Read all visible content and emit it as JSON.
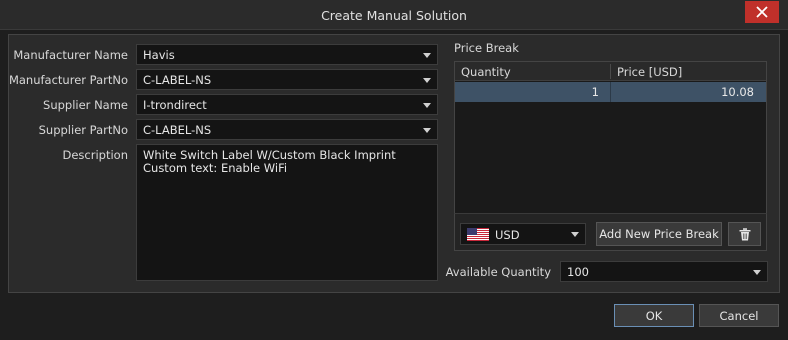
{
  "dialog": {
    "title": "Create Manual Solution"
  },
  "form": {
    "manufacturer_name": {
      "label": "Manufacturer Name",
      "value": "Havis"
    },
    "manufacturer_partno": {
      "label": "Manufacturer PartNo",
      "value": "C-LABEL-NS"
    },
    "supplier_name": {
      "label": "Supplier Name",
      "value": "I-trondirect"
    },
    "supplier_partno": {
      "label": "Supplier PartNo",
      "value": "C-LABEL-NS"
    },
    "description": {
      "label": "Description",
      "lines": [
        "White Switch Label W/Custom Black Imprint",
        "Custom text: Enable WiFi"
      ]
    }
  },
  "price_break": {
    "title": "Price Break",
    "columns": [
      "Quantity",
      "Price [USD]"
    ],
    "rows": [
      {
        "quantity": "1",
        "price": "10.08"
      }
    ],
    "currency": "USD",
    "add_button": "Add New Price Break",
    "delete_icon": "trash-icon"
  },
  "availability": {
    "label": "Available Quantity",
    "value": "100"
  },
  "buttons": {
    "ok": "OK",
    "cancel": "Cancel"
  },
  "colors": {
    "close_button": "#c0302a",
    "selected_row": "#3e5266",
    "primary_border": "#6a8fb5"
  }
}
